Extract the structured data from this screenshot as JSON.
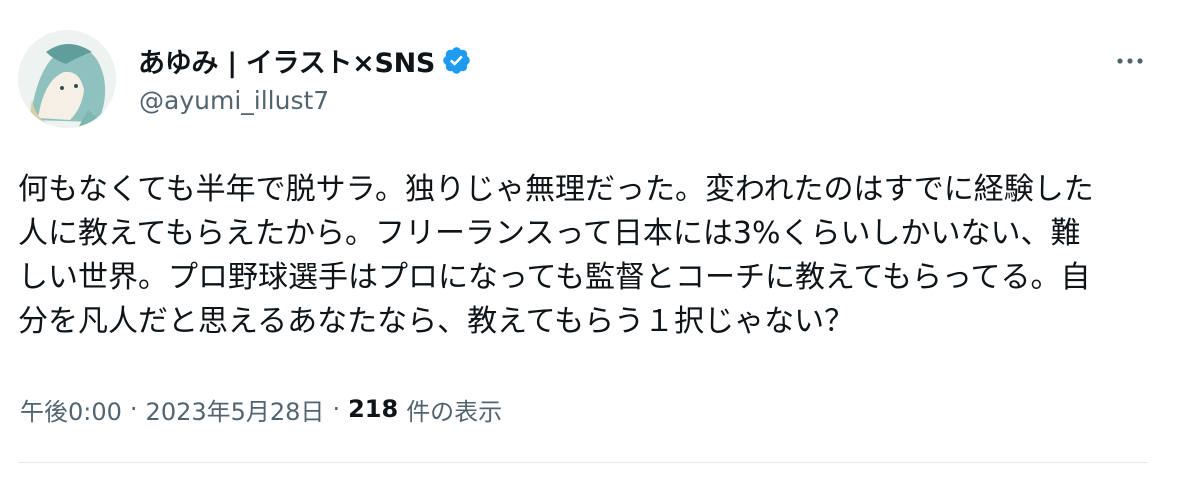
{
  "author": {
    "display_name": "あゆみ | イラスト×SNS",
    "handle": "@ayumi_illust7",
    "verified": true,
    "verified_color": "#1d9bf0",
    "avatar_icon": "illustrated-portrait-avatar"
  },
  "tweet": {
    "text": "何もなくても半年で脱サラ。独りじゃ無理だった。変われたのはすでに経験した\n人に教えてもらえたから。フリーランスって日本には3%くらいしかいない、難\nしい世界。プロ野球選手はプロになっても監督とコーチに教えてもらってる。自\n分を凡人だと思えるあなたなら、教えてもらう１択じゃない？"
  },
  "meta": {
    "time": "午後0:00",
    "separator": "·",
    "date": "2023年5月28日",
    "view_count": "218",
    "view_label": "件の表示"
  },
  "more_icon": "more-horizontal-icon",
  "colors": {
    "text": "#0f1419",
    "secondary": "#536471",
    "divider": "#e6e9eb"
  }
}
